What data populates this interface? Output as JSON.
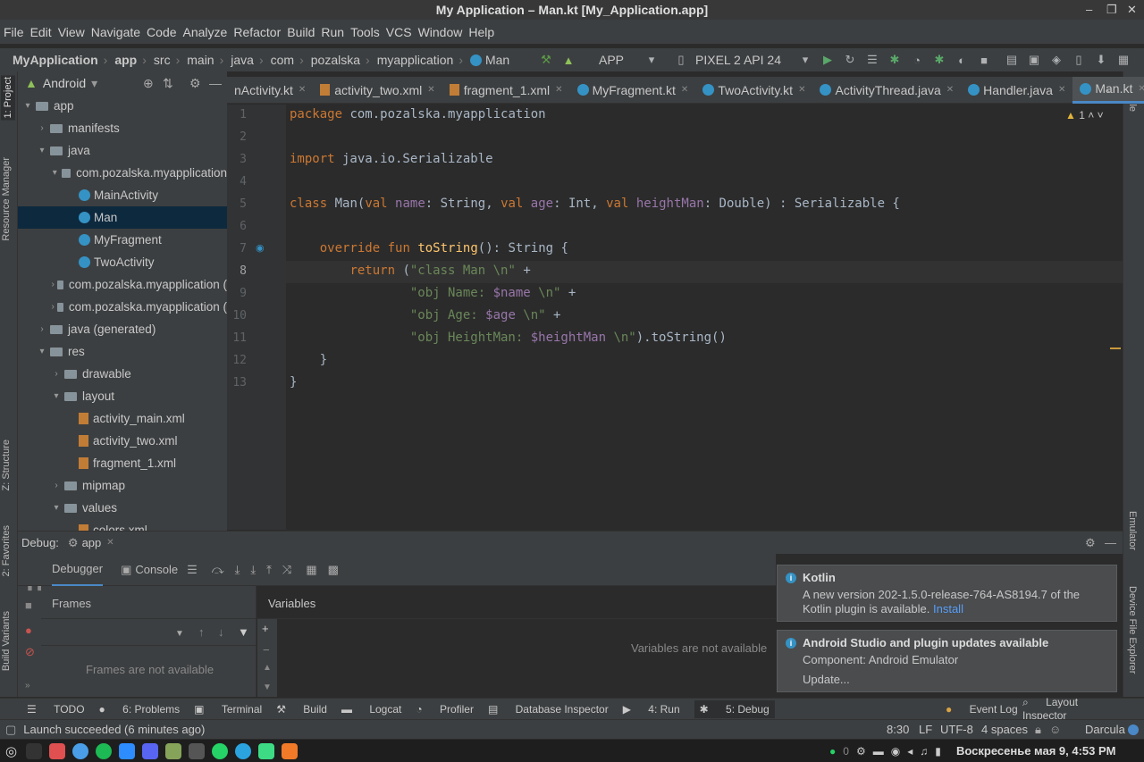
{
  "window": {
    "title": "My Application – Man.kt [My_Application.app]",
    "controls": [
      "–",
      "❐",
      "✕"
    ]
  },
  "menu": [
    "File",
    "Edit",
    "View",
    "Navigate",
    "Code",
    "Analyze",
    "Refactor",
    "Build",
    "Run",
    "Tools",
    "VCS",
    "Window",
    "Help"
  ],
  "breadcrumb": [
    "MyApplication",
    "app",
    "src",
    "main",
    "java",
    "com",
    "pozalska",
    "myapplication",
    "Man"
  ],
  "toolbar": {
    "config": "APP",
    "device": "PIXEL 2 API 24"
  },
  "project_panel": {
    "view": "Android"
  },
  "tree": [
    {
      "label": "app",
      "depth": 0,
      "open": true,
      "type": "folder"
    },
    {
      "label": "manifests",
      "depth": 1,
      "open": false,
      "type": "folder"
    },
    {
      "label": "java",
      "depth": 1,
      "open": true,
      "type": "folder"
    },
    {
      "label": "com.pozalska.myapplication",
      "depth": 2,
      "open": true,
      "type": "folder"
    },
    {
      "label": "MainActivity",
      "depth": 3,
      "type": "kt"
    },
    {
      "label": "Man",
      "depth": 3,
      "type": "kt",
      "selected": true
    },
    {
      "label": "MyFragment",
      "depth": 3,
      "type": "kt"
    },
    {
      "label": "TwoActivity",
      "depth": 3,
      "type": "kt"
    },
    {
      "label": "com.pozalska.myapplication (",
      "depth": 2,
      "open": false,
      "type": "folder"
    },
    {
      "label": "com.pozalska.myapplication (",
      "depth": 2,
      "open": false,
      "type": "folder"
    },
    {
      "label": "java (generated)",
      "depth": 1,
      "open": false,
      "type": "folder"
    },
    {
      "label": "res",
      "depth": 1,
      "open": true,
      "type": "folder"
    },
    {
      "label": "drawable",
      "depth": 2,
      "open": false,
      "type": "folder"
    },
    {
      "label": "layout",
      "depth": 2,
      "open": true,
      "type": "folder"
    },
    {
      "label": "activity_main.xml",
      "depth": 3,
      "type": "xml"
    },
    {
      "label": "activity_two.xml",
      "depth": 3,
      "type": "xml"
    },
    {
      "label": "fragment_1.xml",
      "depth": 3,
      "type": "xml"
    },
    {
      "label": "mipmap",
      "depth": 2,
      "open": false,
      "type": "folder"
    },
    {
      "label": "values",
      "depth": 2,
      "open": true,
      "type": "folder"
    },
    {
      "label": "colors.xml",
      "depth": 3,
      "type": "xml"
    }
  ],
  "tabs": [
    {
      "label": "nActivity.kt"
    },
    {
      "label": "activity_two.xml"
    },
    {
      "label": "fragment_1.xml"
    },
    {
      "label": "MyFragment.kt"
    },
    {
      "label": "TwoActivity.kt"
    },
    {
      "label": "ActivityThread.java"
    },
    {
      "label": "Handler.java"
    },
    {
      "label": "Man.kt",
      "active": true
    }
  ],
  "inspection": "1",
  "code_lines": [
    "package com.pozalska.myapplication",
    "",
    "import java.io.Serializable",
    "",
    "class Man(val name: String, val age: Int, val heightMan: Double) : Serializable {",
    "",
    "    override fun toString(): String {",
    "        return (\"class Man \\n\" +",
    "                \"obj Name: $name \\n\" +",
    "                \"obj Age: $age \\n\" +",
    "                \"obj HeightMan: $heightMan \\n\").toString()",
    "    }",
    "}"
  ],
  "left_tabs": [
    "1: Project",
    "Resource Manager",
    "Z: Structure",
    "2: Favorites",
    "Build Variants"
  ],
  "right_tabs": [
    "Gradle",
    "Emulator",
    "Device File Explorer"
  ],
  "debug": {
    "label": "Debug:",
    "config": "app",
    "tabs": [
      "Debugger",
      "Console"
    ],
    "frames_header": "Frames",
    "variables_header": "Variables",
    "frames_empty": "Frames are not available",
    "variables_empty": "Variables are not available"
  },
  "notifications": [
    {
      "title": "Kotlin",
      "body": "A new version 202-1.5.0-release-764-AS8194.7 of the Kotlin plugin is available.",
      "link": "Install"
    },
    {
      "title": "Android Studio and plugin updates available",
      "body": "Component: Android Emulator",
      "link": "Update..."
    }
  ],
  "bottom_tools": [
    "TODO",
    "6: Problems",
    "Terminal",
    "Build",
    "Logcat",
    "Profiler",
    "Database Inspector",
    "4: Run",
    "5: Debug"
  ],
  "bottom_right": [
    "Event Log",
    "Layout Inspector"
  ],
  "status": {
    "message": "Launch succeeded (6 minutes ago)",
    "position": "8:30",
    "line_sep": "LF",
    "encoding": "UTF-8",
    "indent": "4 spaces",
    "theme": "Darcula"
  },
  "taskbar": {
    "clock": "Воскресенье мая 9, 4:53 PM",
    "tray_count": "0"
  }
}
